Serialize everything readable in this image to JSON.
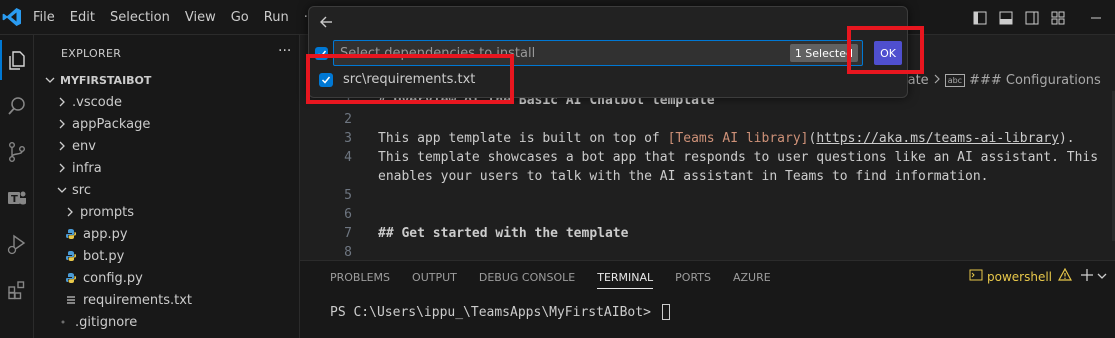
{
  "menu": {
    "file": "File",
    "edit": "Edit",
    "selection": "Selection",
    "view": "View",
    "go": "Go",
    "run": "Run",
    "more": "···"
  },
  "sidebar": {
    "title": "EXPLORER",
    "more": "···",
    "root": "MYFIRSTAIBOT",
    "items": [
      {
        "label": ".vscode",
        "kind": "folder-collapsed"
      },
      {
        "label": "appPackage",
        "kind": "folder-collapsed"
      },
      {
        "label": "env",
        "kind": "folder-collapsed"
      },
      {
        "label": "infra",
        "kind": "folder-collapsed"
      },
      {
        "label": "src",
        "kind": "folder-expanded"
      },
      {
        "label": "prompts",
        "kind": "folder-collapsed"
      },
      {
        "label": "app.py",
        "kind": "python-file"
      },
      {
        "label": "bot.py",
        "kind": "python-file"
      },
      {
        "label": "config.py",
        "kind": "python-file"
      },
      {
        "label": "requirements.txt",
        "kind": "text-file"
      },
      {
        "label": ".gitignore",
        "kind": "gitignore-file"
      }
    ]
  },
  "editor": {
    "breadcrumb": {
      "prev": "late",
      "symbol": "abc",
      "current": "### Configurations"
    },
    "lines": [
      {
        "n": "1",
        "text": "# Overview of the Basic AI Chatbot template"
      },
      {
        "n": "2",
        "text": ""
      },
      {
        "n": "3",
        "pre": "This app template is built on top of ",
        "link_text": "[Teams AI library]",
        "paren_open": "(",
        "link_url": "https://aka.ms/teams-ai-library",
        "post": ")."
      },
      {
        "n": "4",
        "text": "This template showcases a bot app that responds to user questions like an AI assistant. This"
      },
      {
        "n": "",
        "text": "enables your users to talk with the AI assistant in Teams to find information."
      },
      {
        "n": "5",
        "text": ""
      },
      {
        "n": "6",
        "text": ""
      },
      {
        "n": "7",
        "text": "## Get started with the template"
      },
      {
        "n": "8",
        "text": ""
      }
    ]
  },
  "panel": {
    "tabs": [
      "PROBLEMS",
      "OUTPUT",
      "DEBUG CONSOLE",
      "TERMINAL",
      "PORTS",
      "AZURE"
    ],
    "active_tab": "TERMINAL",
    "shell": "powershell",
    "prompt": "PS C:\\Users\\ippu_\\TeamsApps\\MyFirstAIBot> "
  },
  "quickpick": {
    "placeholder": "Select dependencies to install",
    "count": "1 Selected",
    "ok": "OK",
    "item": "src\\requirements.txt"
  },
  "colors": {
    "accent": "#0078d4",
    "highlight": "#e8161f",
    "ok_button": "#4f4fcf"
  }
}
